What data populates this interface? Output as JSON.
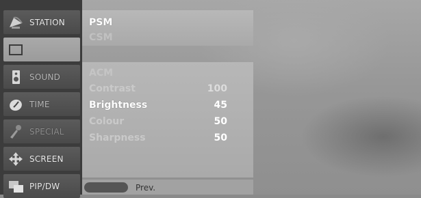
{
  "menu": {
    "items": [
      {
        "label": "STATION",
        "icon": "satellite-dish-icon"
      },
      {
        "label": "",
        "icon": "picture-screen-icon"
      },
      {
        "label": "SOUND",
        "icon": "speaker-icon"
      },
      {
        "label": "TIME",
        "icon": "clock-icon"
      },
      {
        "label": "SPECIAL",
        "icon": "key-icon"
      },
      {
        "label": "SCREEN",
        "icon": "move-arrows-icon"
      },
      {
        "label": "PIP/DW",
        "icon": "pip-windows-icon"
      }
    ]
  },
  "panel": {
    "options": [
      {
        "label": "PSM",
        "value": ""
      },
      {
        "label": "CSM",
        "value": ""
      },
      {
        "label": "ACM",
        "value": ""
      },
      {
        "label": "Contrast",
        "value": "100"
      },
      {
        "label": "Brightness",
        "value": "45"
      },
      {
        "label": "Colour",
        "value": "50"
      },
      {
        "label": "Sharpness",
        "value": "50"
      }
    ],
    "prev_label": "Prev."
  }
}
